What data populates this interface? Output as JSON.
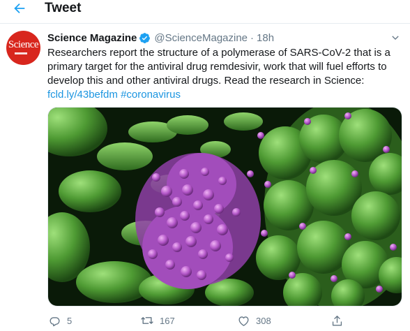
{
  "header": {
    "title": "Tweet"
  },
  "tweet": {
    "display_name": "Science Magazine",
    "handle": "@ScienceMagazine",
    "separator": "·",
    "time": "18h",
    "avatar_word": "Science",
    "text_main": "Researchers report the structure of a polymerase of SARS-CoV-2 that is a primary target for the antiviral drug remdesivir, work that will fuel efforts to develop this and other antiviral drugs. Read the research in Science:",
    "link": "fcld.ly/43befdm",
    "hashtag": "#coronavirus",
    "replies": "5",
    "retweets": "167",
    "likes": "308"
  },
  "icons": {
    "back": "back-arrow-icon",
    "verified": "verified-badge-icon",
    "caret": "chevron-down-icon",
    "reply": "reply-icon",
    "retweet": "retweet-icon",
    "like": "heart-icon",
    "share": "share-icon"
  },
  "colors": {
    "accent": "#1da1f2",
    "link": "#1b95e0",
    "muted": "#657786",
    "avatar_bg": "#d8261d"
  }
}
